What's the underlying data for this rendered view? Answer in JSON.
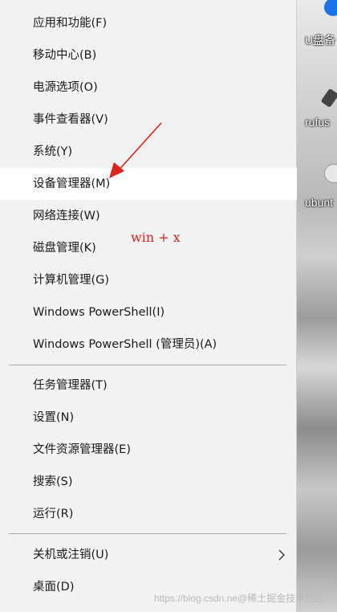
{
  "desktop": {
    "icons": [
      {
        "label": "U盘备",
        "icon": "usb-drive-icon",
        "color": "#1a73e8"
      },
      {
        "label": "rufus",
        "icon": "usb-stick-icon",
        "color": "#444444"
      },
      {
        "label": "ubunt",
        "icon": "disc-image-icon",
        "color": "#e8e8e8"
      }
    ]
  },
  "menu": {
    "items": [
      {
        "label": "应用和功能(F)"
      },
      {
        "label": "移动中心(B)"
      },
      {
        "label": "电源选项(O)"
      },
      {
        "label": "事件查看器(V)"
      },
      {
        "label": "系统(Y)"
      },
      {
        "label": "设备管理器(M)",
        "highlighted": true
      },
      {
        "label": "网络连接(W)"
      },
      {
        "label": "磁盘管理(K)"
      },
      {
        "label": "计算机管理(G)"
      },
      {
        "label": "Windows PowerShell(I)"
      },
      {
        "label": "Windows PowerShell (管理员)(A)"
      },
      {
        "label": "任务管理器(T)"
      },
      {
        "label": "设置(N)"
      },
      {
        "label": "文件资源管理器(E)"
      },
      {
        "label": "搜索(S)"
      },
      {
        "label": "运行(R)"
      },
      {
        "label": "关机或注销(U)",
        "has_submenu": true
      },
      {
        "label": "桌面(D)"
      }
    ]
  },
  "annotation": {
    "text": "win + x",
    "color": "#e0211d"
  },
  "watermark": {
    "text": "https://blog.csdn.ne@稀土掘金技术社区"
  }
}
